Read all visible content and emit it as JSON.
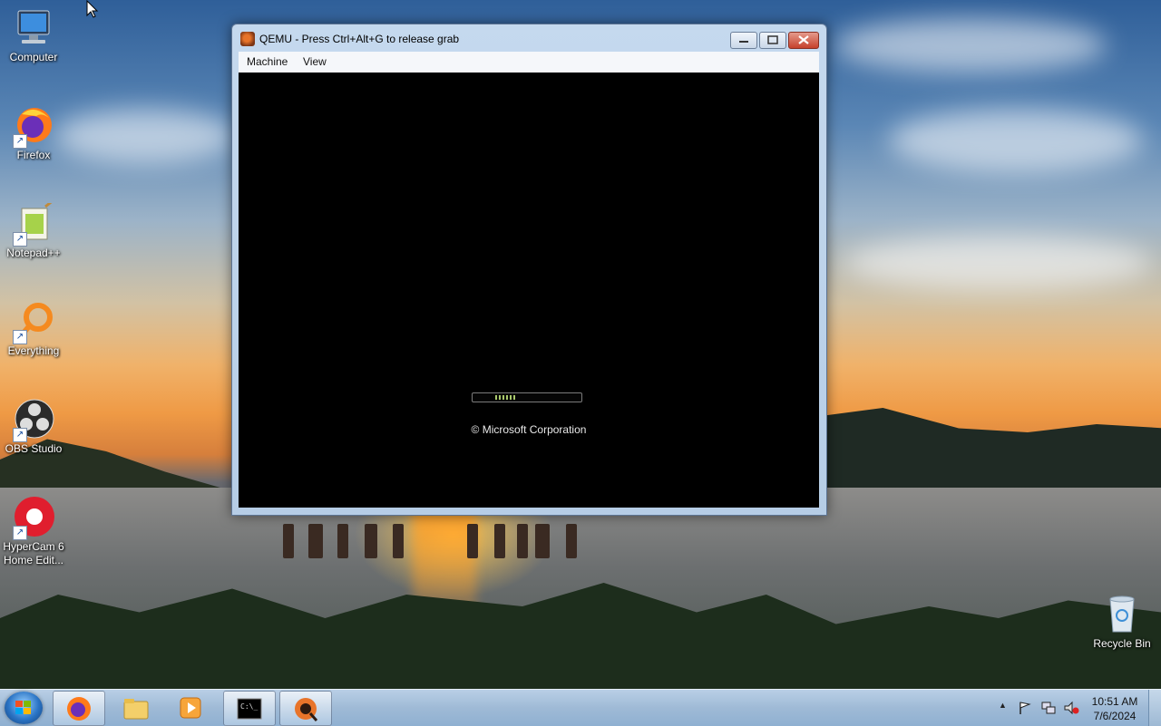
{
  "desktop": {
    "icons": [
      {
        "label": "Computer",
        "icon": "computer-icon"
      },
      {
        "label": "Firefox",
        "icon": "firefox-icon"
      },
      {
        "label": "Notepad++",
        "icon": "notepadpp-icon"
      },
      {
        "label": "Everything",
        "icon": "everything-icon"
      },
      {
        "label": "OBS Studio",
        "icon": "obs-icon"
      },
      {
        "label": "HyperCam 6 Home Edit...",
        "icon": "hypercam-icon"
      }
    ],
    "recycle_bin": {
      "label": "Recycle Bin",
      "icon": "recycle-bin-icon"
    }
  },
  "window": {
    "title": "QEMU - Press Ctrl+Alt+G to release grab",
    "buttons": {
      "minimize": "▭",
      "maximize": "□",
      "close": "✕"
    },
    "menu": [
      "Machine",
      "View"
    ],
    "guest_screen": {
      "copyright": "© Microsoft Corporation",
      "progress_label": "boot-progress-indicator"
    }
  },
  "taskbar": {
    "pinned": [
      {
        "name": "firefox",
        "icon": "firefox-icon",
        "active": true
      },
      {
        "name": "file-explorer",
        "icon": "folder-icon",
        "active": false
      },
      {
        "name": "media-player",
        "icon": "media-player-icon",
        "active": false
      },
      {
        "name": "command-prompt",
        "icon": "terminal-icon",
        "active": true
      },
      {
        "name": "qemu",
        "icon": "qemu-icon",
        "active": true
      }
    ],
    "tray": {
      "chevron": "▲",
      "icons": [
        "flag-icon",
        "network-icon",
        "volume-muted-icon"
      ]
    },
    "clock": {
      "time": "10:51 AM",
      "date": "7/6/2024"
    }
  },
  "colors": {
    "taskbar": "#9fbad6",
    "window_frame": "#b6cde6",
    "close_button": "#c6412c",
    "progress_segment": "#a9c96c"
  }
}
